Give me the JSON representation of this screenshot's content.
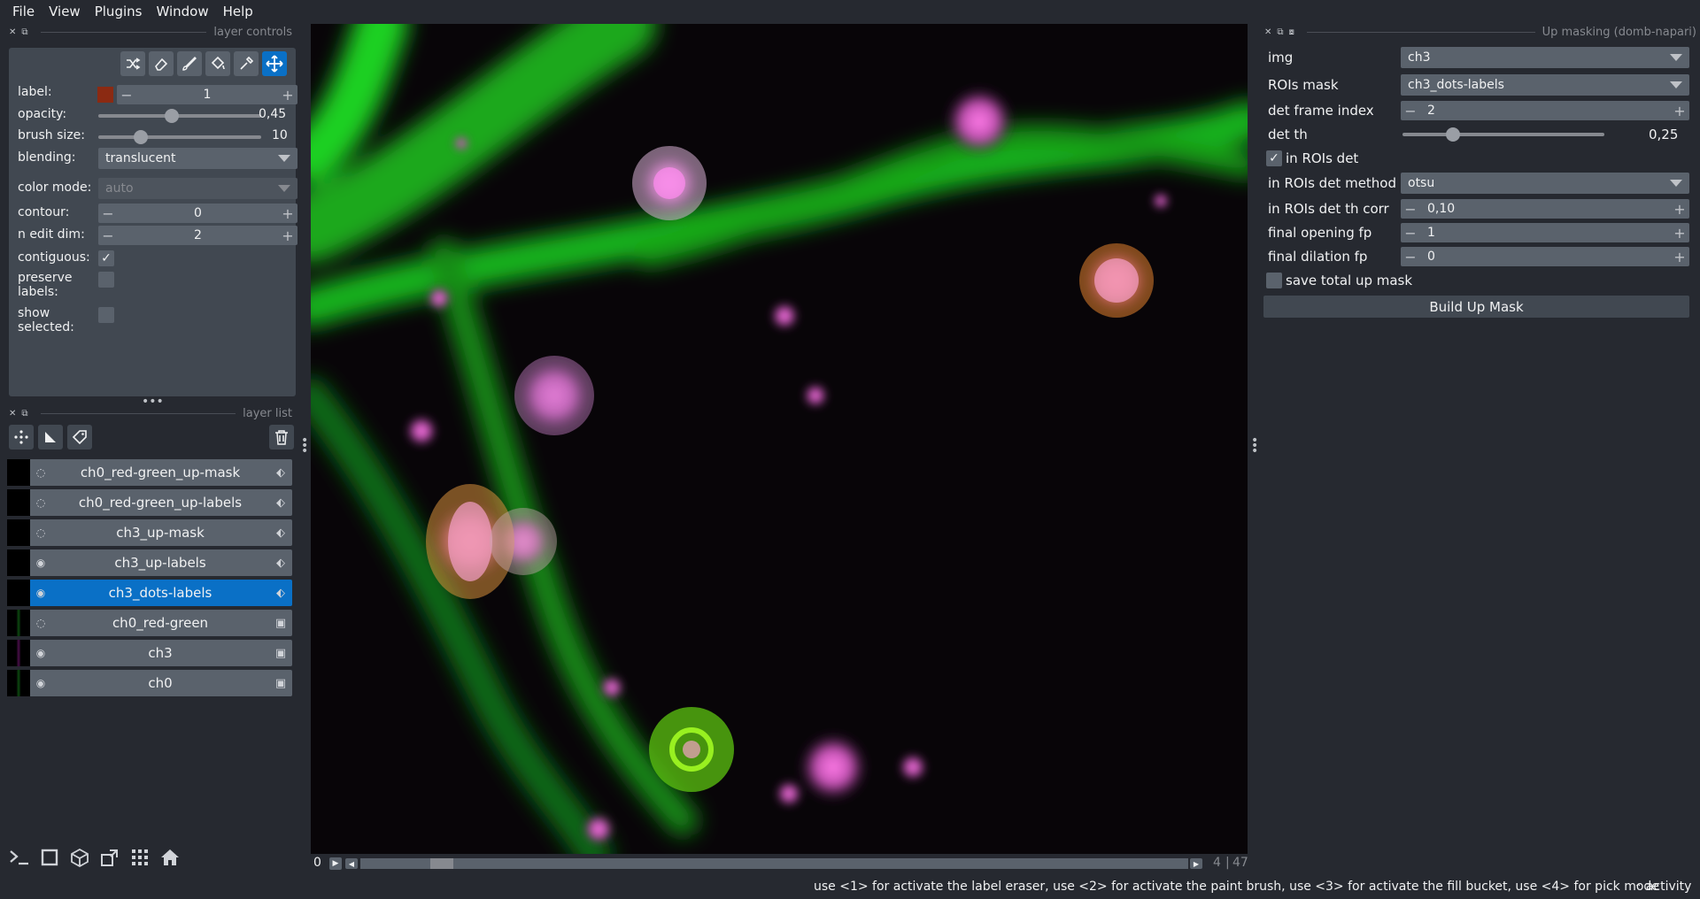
{
  "menubar": {
    "items": [
      "File",
      "View",
      "Plugins",
      "Window",
      "Help"
    ]
  },
  "layer_controls": {
    "title": "layer controls",
    "tools": [
      "shuffle-icon",
      "eraser-icon",
      "brush-icon",
      "fill-bucket-icon",
      "picker-icon",
      "pan-zoom-icon"
    ],
    "label_label": "label:",
    "label_value": "1",
    "label_color": "#8b2a12",
    "opacity_label": "opacity:",
    "opacity_value": "0,45",
    "opacity_fraction": 0.45,
    "brush_size_label": "brush size:",
    "brush_size_value": "10",
    "brush_size_fraction": 0.26,
    "blending_label": "blending:",
    "blending_value": "translucent",
    "color_mode_label": "color mode:",
    "color_mode_value": "auto",
    "contour_label": "contour:",
    "contour_value": "0",
    "n_edit_dim_label": "n edit dim:",
    "n_edit_dim_value": "2",
    "contiguous_label": "contiguous:",
    "contiguous_checked": "✓",
    "preserve_labels_label_1": "preserve",
    "preserve_labels_label_2": "labels:",
    "show_selected_label_1": "show",
    "show_selected_label_2": "selected:"
  },
  "layer_list": {
    "title": "layer list",
    "layers": [
      {
        "name": "ch0_red-green_up-mask",
        "type": "labels",
        "visible": false,
        "selected": false
      },
      {
        "name": "ch0_red-green_up-labels",
        "type": "labels",
        "visible": false,
        "selected": false
      },
      {
        "name": "ch3_up-mask",
        "type": "labels",
        "visible": false,
        "selected": false
      },
      {
        "name": "ch3_up-labels",
        "type": "labels",
        "visible": true,
        "selected": false
      },
      {
        "name": "ch3_dots-labels",
        "type": "labels",
        "visible": true,
        "selected": true
      },
      {
        "name": "ch0_red-green",
        "type": "image",
        "visible": false,
        "selected": false
      },
      {
        "name": "ch3",
        "type": "image",
        "visible": true,
        "selected": false
      },
      {
        "name": "ch0",
        "type": "image",
        "visible": true,
        "selected": false
      }
    ]
  },
  "viewer": {
    "frame_start": "0",
    "frame_current": "4",
    "frame_total": "47",
    "frame_fraction": 0.085
  },
  "plugin": {
    "title": "Up masking (domb-napari)",
    "img_label": "img",
    "img_value": "ch3",
    "rois_mask_label": "ROIs mask",
    "rois_mask_value": "ch3_dots-labels",
    "det_frame_index_label": "det frame index",
    "det_frame_index_value": "2",
    "det_th_label": "det th",
    "det_th_value": "0,25",
    "det_th_fraction": 0.25,
    "in_rois_det_label": "in ROIs det",
    "in_rois_det_checked": "✓",
    "in_rois_det_method_label": "in ROIs det method",
    "in_rois_det_method_value": "otsu",
    "in_rois_det_th_corr_label": "in ROIs det th corr",
    "in_rois_det_th_corr_value": "0,10",
    "final_opening_fp_label": "final opening fp",
    "final_opening_fp_value": "1",
    "final_dilation_fp_label": "final dilation fp",
    "final_dilation_fp_value": "0",
    "save_total_up_mask_label": "save total up mask",
    "build_button": "Build Up Mask"
  },
  "status": {
    "message": "use <1> for activate the label eraser, use <2> for activate the paint brush, use <3> for activate the fill bucket, use <4> for pick mode",
    "activity": "activity"
  },
  "colors": {
    "background": "#262930",
    "panel": "#414851",
    "control": "#5a626c",
    "accent": "#0a70c6"
  }
}
